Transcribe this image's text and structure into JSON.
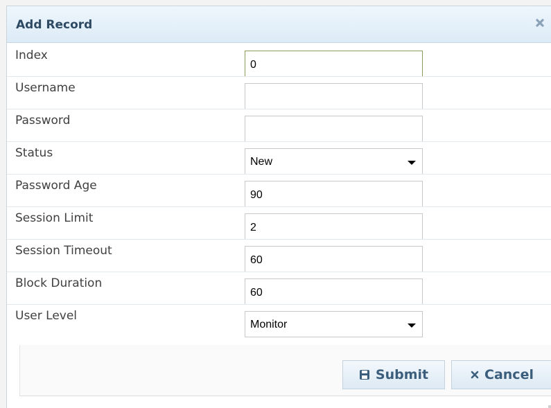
{
  "dialog": {
    "title": "Add Record",
    "close_icon": "close-icon"
  },
  "fields": [
    {
      "label": "Index",
      "type": "text",
      "value": "0",
      "focused": true
    },
    {
      "label": "Username",
      "type": "text",
      "value": ""
    },
    {
      "label": "Password",
      "type": "text",
      "value": ""
    },
    {
      "label": "Status",
      "type": "select",
      "value": "New"
    },
    {
      "label": "Password Age",
      "type": "text",
      "value": "90"
    },
    {
      "label": "Session Limit",
      "type": "text",
      "value": "2"
    },
    {
      "label": "Session Timeout",
      "type": "text",
      "value": "60"
    },
    {
      "label": "Block Duration",
      "type": "text",
      "value": "60"
    },
    {
      "label": "User Level",
      "type": "select",
      "value": "Monitor"
    }
  ],
  "buttons": {
    "submit_label": "Submit",
    "submit_icon": "floppy-disk-icon",
    "cancel_label": "Cancel",
    "cancel_icon": "close-icon"
  },
  "colors": {
    "title_text": "#2e4a63",
    "button_text": "#3b5e7c",
    "focus_border": "#8a9a5b"
  }
}
